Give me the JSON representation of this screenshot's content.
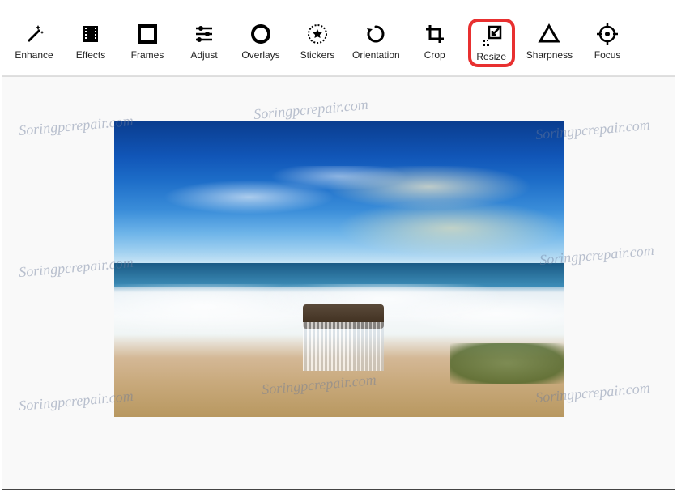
{
  "watermark_text": "Soringpcrepair.com",
  "selected_tool": "resize",
  "toolbar": {
    "items": [
      {
        "id": "enhance",
        "label": "Enhance"
      },
      {
        "id": "effects",
        "label": "Effects"
      },
      {
        "id": "frames",
        "label": "Frames"
      },
      {
        "id": "adjust",
        "label": "Adjust"
      },
      {
        "id": "overlays",
        "label": "Overlays"
      },
      {
        "id": "stickers",
        "label": "Stickers"
      },
      {
        "id": "orientation",
        "label": "Orientation"
      },
      {
        "id": "crop",
        "label": "Crop"
      },
      {
        "id": "resize",
        "label": "Resize"
      },
      {
        "id": "sharpness",
        "label": "Sharpness"
      },
      {
        "id": "focus",
        "label": "Focus"
      }
    ]
  }
}
